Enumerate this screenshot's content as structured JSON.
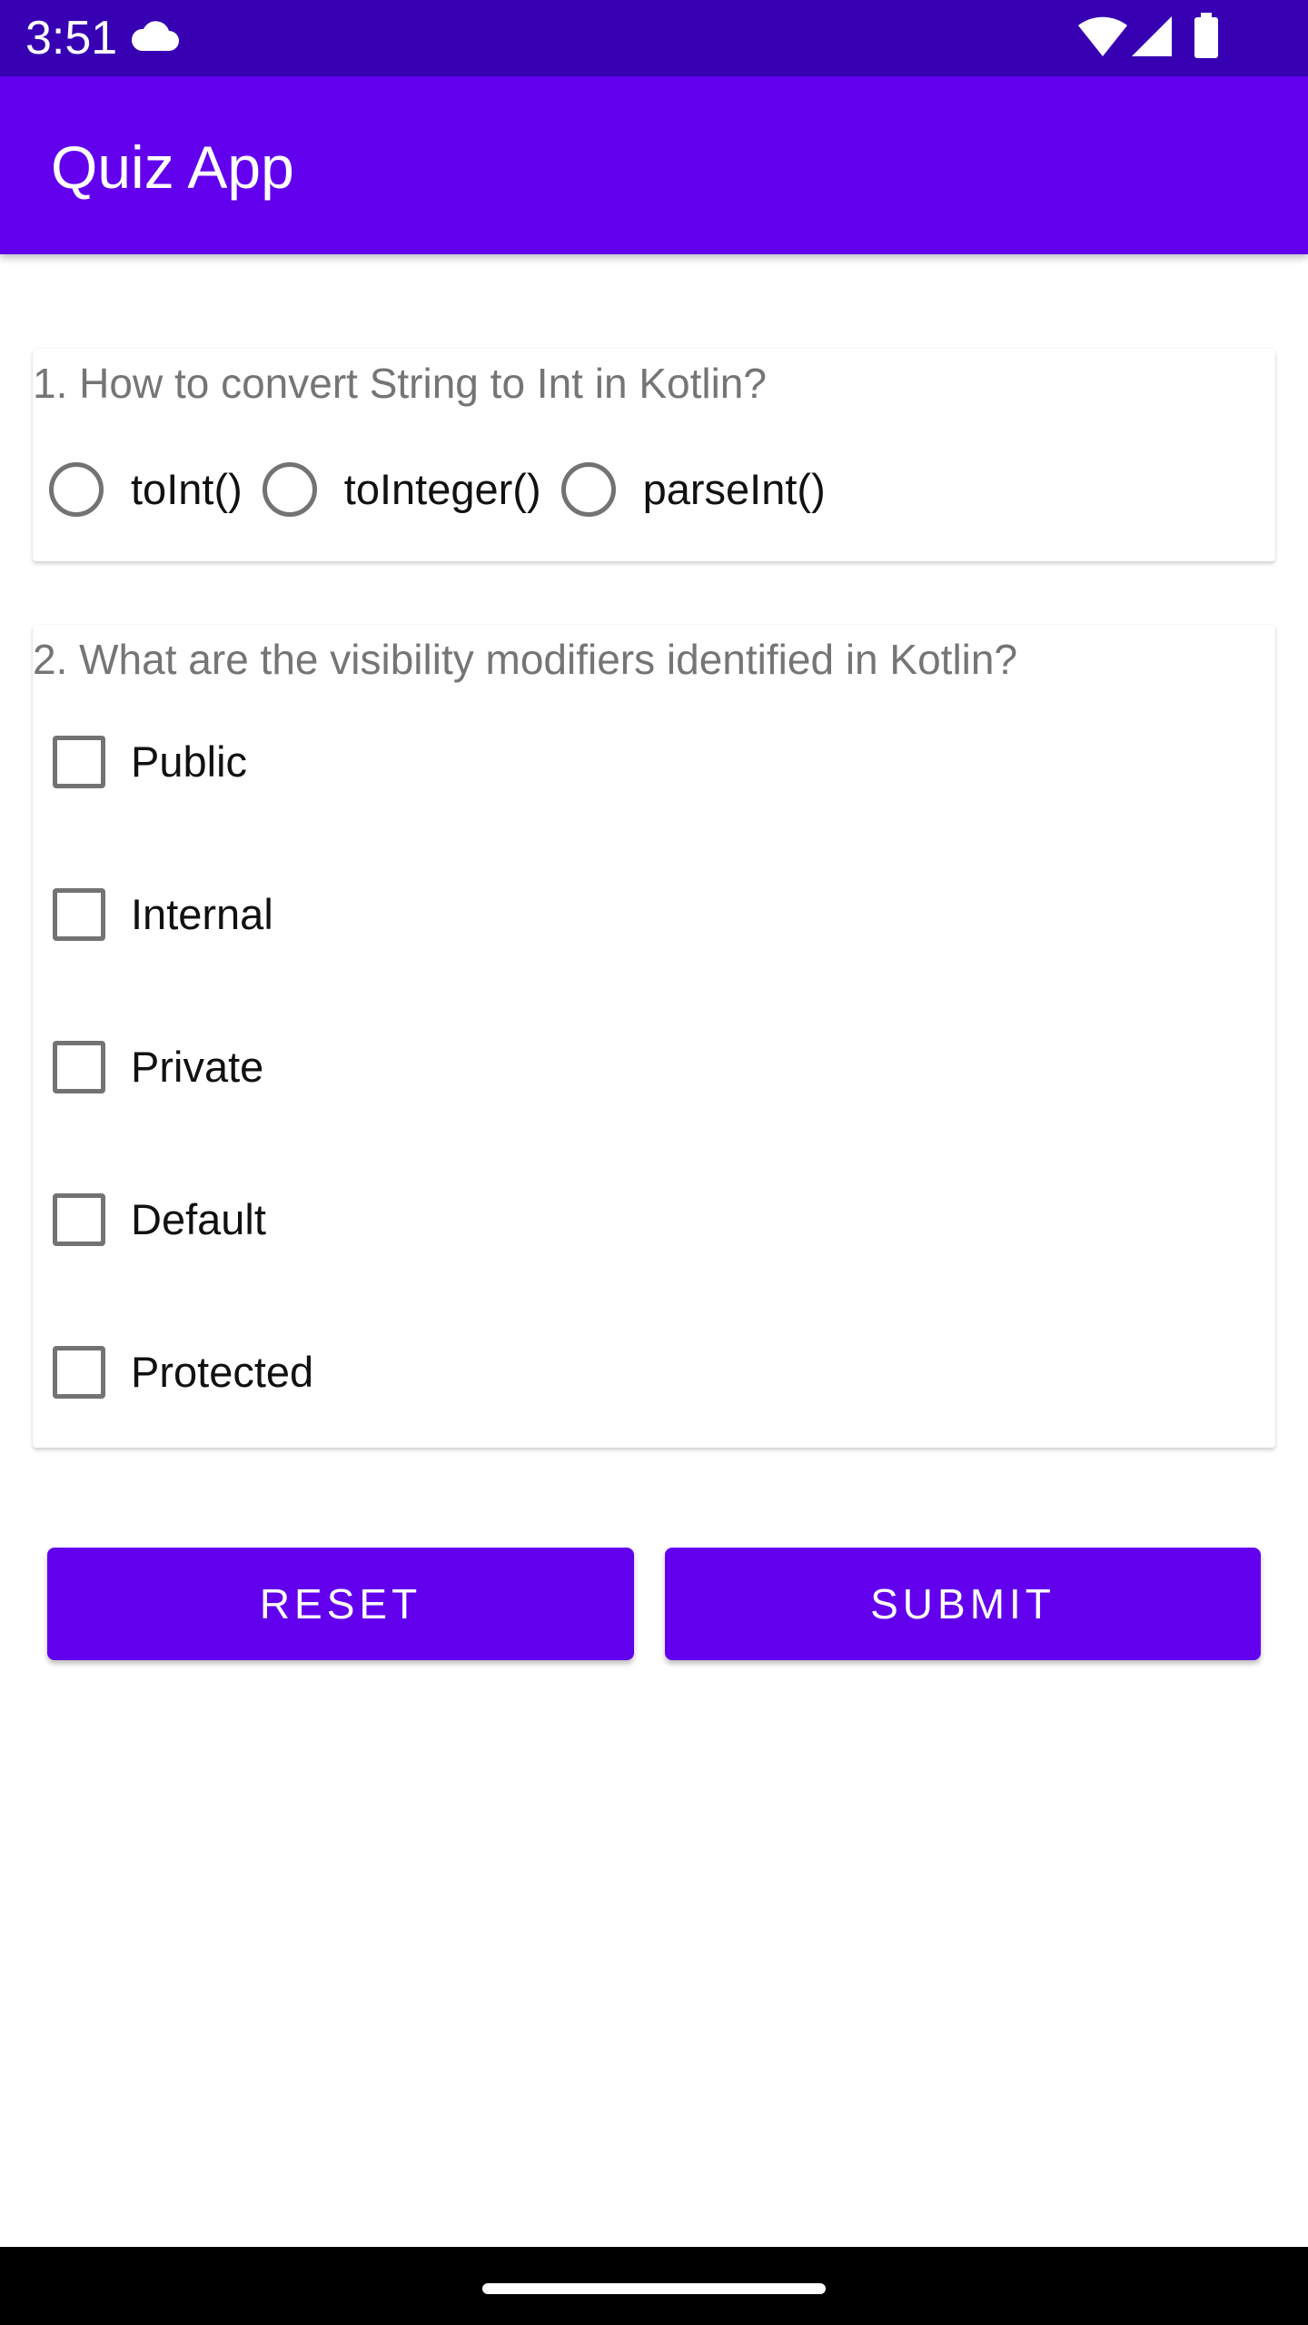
{
  "status_bar": {
    "time": "3:51",
    "icons": [
      "cloud-icon",
      "wifi-icon",
      "signal-icon",
      "battery-icon"
    ],
    "background": "#3700b3"
  },
  "app_bar": {
    "title": "Quiz App",
    "background": "#6200ee"
  },
  "question1": {
    "text": "1. How to convert String to Int in Kotlin?",
    "options": [
      {
        "label": "toInt()",
        "selected": false
      },
      {
        "label": "toInteger()",
        "selected": false
      },
      {
        "label": "parseInt()",
        "selected": false
      }
    ]
  },
  "question2": {
    "text": "2. What are the visibility modifiers identified in Kotlin?",
    "options": [
      {
        "label": "Public",
        "checked": false
      },
      {
        "label": "Internal",
        "checked": false
      },
      {
        "label": "Private",
        "checked": false
      },
      {
        "label": "Default",
        "checked": false
      },
      {
        "label": "Protected",
        "checked": false
      }
    ]
  },
  "buttons": {
    "reset_label": "RESET",
    "submit_label": "SUBMIT",
    "color": "#6200ee"
  },
  "nav_bar": {
    "icons": [
      "home-handle"
    ]
  }
}
